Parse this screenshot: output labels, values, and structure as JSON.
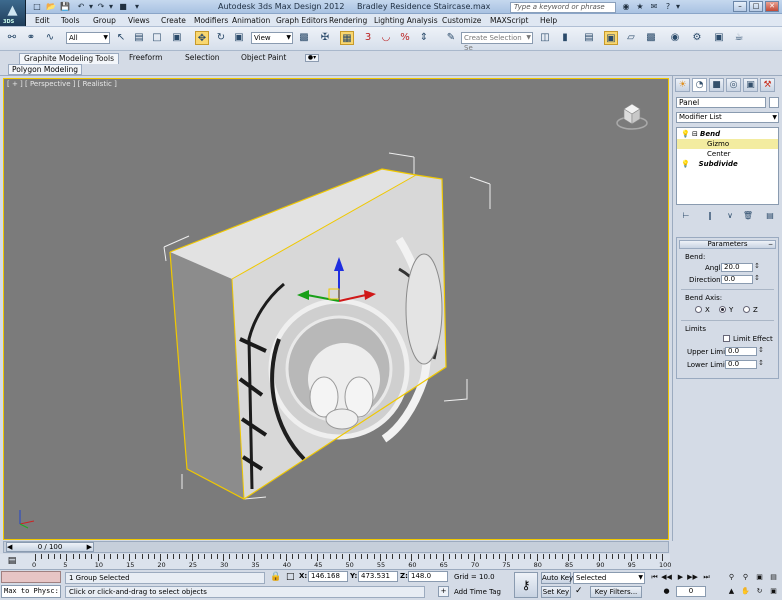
{
  "window": {
    "app_title": "Autodesk 3ds Max Design 2012",
    "file_title": "Bradley Residence Staircase.max",
    "logo_text": "3DS",
    "search_placeholder": "Type a keyword or phrase",
    "min_glyph": "–",
    "max_glyph": "□",
    "close_glyph": "✕"
  },
  "menu": [
    "Edit",
    "Tools",
    "Group",
    "Views",
    "Create",
    "Modifiers",
    "Animation",
    "Graph Editors",
    "Rendering",
    "Lighting Analysis",
    "Customize",
    "MAXScript",
    "Help"
  ],
  "toolbar": {
    "selection_filter": "All",
    "ref_coord": "View",
    "named_selection_placeholder": "Create Selection Se",
    "snap_label": "3"
  },
  "ribbon": {
    "tabs": [
      "Graphite Modeling Tools",
      "Freeform",
      "Selection",
      "Object Paint"
    ],
    "sub_tab": "Polygon Modeling"
  },
  "viewport": {
    "label": "[ + ] [ Perspective ] [ Realistic ]"
  },
  "command_panel": {
    "object_name": "Panel",
    "modifier_list": "Modifier List",
    "stack": [
      {
        "label": "Bend",
        "bold": true
      },
      {
        "label": "Gizmo",
        "bold": false
      },
      {
        "label": "Center",
        "bold": false
      },
      {
        "label": "Subdivide",
        "bold": true
      }
    ],
    "parameters": {
      "title": "Parameters",
      "bend_label": "Bend:",
      "angle_label": "Angle:",
      "angle_value": "20.0",
      "direction_label": "Direction:",
      "direction_value": "0.0",
      "bend_axis_label": "Bend Axis:",
      "axis_x": "X",
      "axis_y": "Y",
      "axis_z": "Z",
      "selected_axis": "Y",
      "limits_label": "Limits",
      "limit_effect_label": "Limit Effect",
      "upper_limit_label": "Upper Limit:",
      "upper_limit_value": "0.0",
      "lower_limit_label": "Lower Limit:",
      "lower_limit_value": "0.0"
    }
  },
  "time_slider": {
    "label": "0 / 100"
  },
  "ruler": {
    "labels": [
      "0",
      "5",
      "10",
      "15",
      "20",
      "25",
      "30",
      "35",
      "40",
      "45",
      "50",
      "55",
      "60",
      "65",
      "70",
      "75",
      "80",
      "85",
      "90",
      "95",
      "100"
    ]
  },
  "status": {
    "maxscript_prompt": "Max to Physc:",
    "selection_info": "1 Group Selected",
    "prompt": "Click or click-and-drag to select objects",
    "x_label": "X:",
    "x_value": "146.168",
    "y_label": "Y:",
    "y_value": "473.531",
    "z_label": "Z:",
    "z_value": "148.0",
    "grid": "Grid = 10.0",
    "add_time_tag": "Add Time Tag",
    "auto_key": "Auto Key",
    "set_key": "Set Key",
    "key_mode": "Selected",
    "key_filters": "Key Filters...",
    "frame": "0"
  },
  "colors": {
    "selection_yellow": "#f0c800",
    "viewport_bg": "#7b7b7b",
    "stack_highlight": "#f3eca0"
  }
}
